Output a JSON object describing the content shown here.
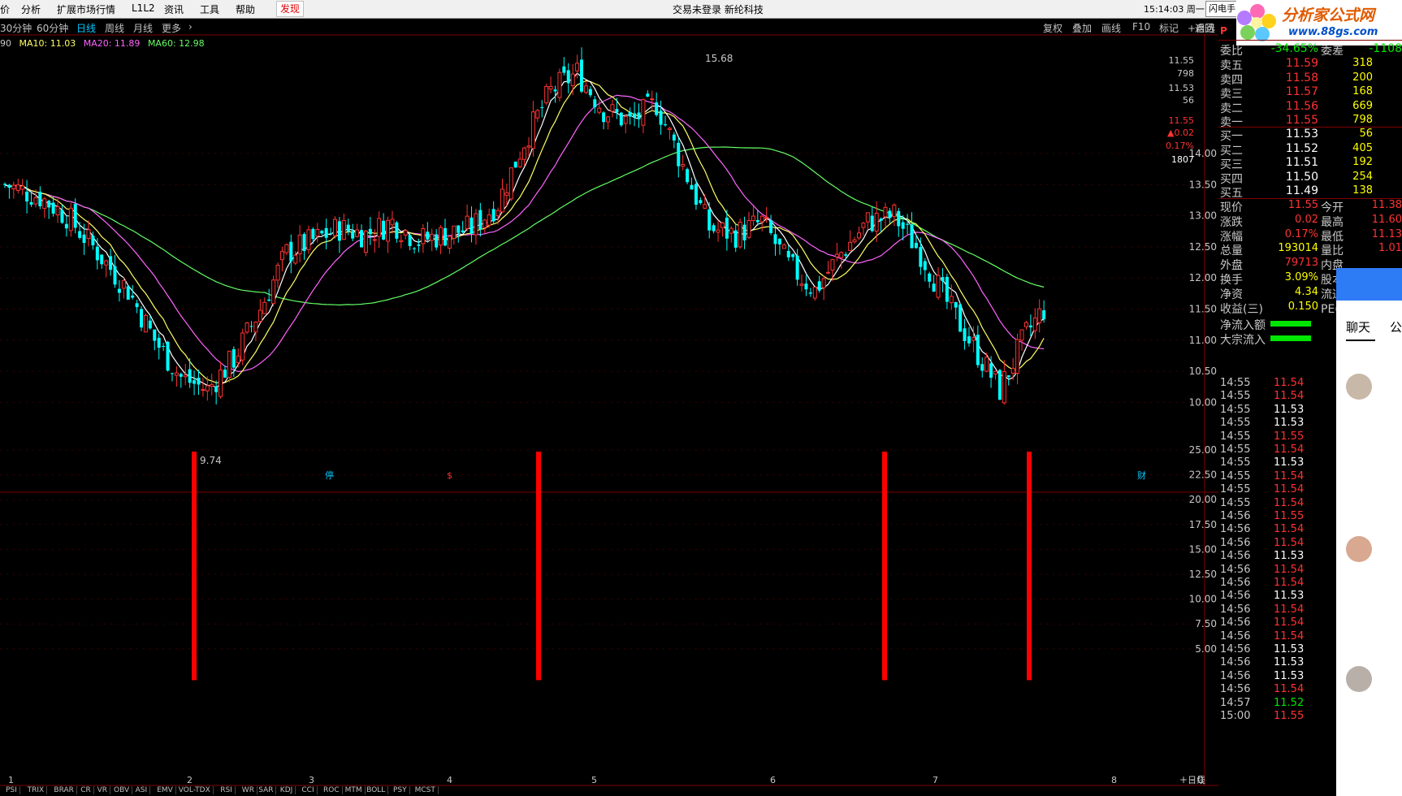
{
  "menu": {
    "items": [
      "价",
      "分析",
      "扩展市场行情",
      "L1L2",
      "资讯",
      "工具",
      "帮助",
      "发现"
    ],
    "center": "交易未登录    新纶科技",
    "clock": "15:14:03 周一",
    "flash": "闪电手"
  },
  "logo": {
    "title": "分析家公式网",
    "url": "www.88gs.com"
  },
  "toolbar": {
    "periods": [
      "30分钟",
      "60分钟",
      "日线",
      "周线",
      "月线",
      "更多"
    ],
    "active_period": "日线",
    "right": [
      "复权",
      "叠加",
      "画线",
      "F10",
      "标记",
      "+自选",
      "返回"
    ]
  },
  "ma": [
    {
      "label": "90",
      "color": "#c8c8c8"
    },
    {
      "label": "MA10: 11.03",
      "color": "#ffff64"
    },
    {
      "label": "MA20: 11.89",
      "color": "#ff64ff"
    },
    {
      "label": "MA60: 12.98",
      "color": "#64ff64"
    }
  ],
  "chart_labels": {
    "high_mark": "15.68",
    "low_mark": "9.74",
    "event_1": "停",
    "event_2": "$",
    "event_3": "财",
    "volume_unit": "日线",
    "top_price_1": "11.55",
    "top_vol_1": "798",
    "top_price_2": "11.53",
    "top_vol_2": "56",
    "top_price_3": "11.55",
    "top_chg": "▲0.02",
    "top_pct": "0.17%",
    "top_vol_3": "1807"
  },
  "price_axis": [
    "14.00",
    "13.50",
    "13.00",
    "12.50",
    "12.00",
    "11.50",
    "11.00",
    "10.50",
    "10.00"
  ],
  "ind_axis": [
    "25.00",
    "22.50",
    "20.00",
    "17.50",
    "15.00",
    "12.50",
    "10.00",
    "7.50",
    "5.00"
  ],
  "x_axis": [
    "1",
    "2",
    "3",
    "4",
    "5",
    "6",
    "7",
    "8"
  ],
  "quote": {
    "wei_bi_label": "委比",
    "wei_bi": "-34.65%",
    "wei_cha_label": "委差",
    "wei_cha": "-1108",
    "asks": [
      {
        "label": "卖五",
        "price": "11.59",
        "vol": "318"
      },
      {
        "label": "卖四",
        "price": "11.58",
        "vol": "200"
      },
      {
        "label": "卖三",
        "price": "11.57",
        "vol": "168"
      },
      {
        "label": "卖二",
        "price": "11.56",
        "vol": "669"
      },
      {
        "label": "卖一",
        "price": "11.55",
        "vol": "798"
      }
    ],
    "bids": [
      {
        "label": "买一",
        "price": "11.53",
        "vol": "56"
      },
      {
        "label": "买二",
        "price": "11.52",
        "vol": "405"
      },
      {
        "label": "买三",
        "price": "11.51",
        "vol": "192"
      },
      {
        "label": "买四",
        "price": "11.50",
        "vol": "254"
      },
      {
        "label": "买五",
        "price": "11.49",
        "vol": "138"
      }
    ],
    "stats": [
      {
        "l1": "现价",
        "v1": "11.55",
        "l2": "今开",
        "v2": "11.38"
      },
      {
        "l1": "涨跌",
        "v1": "0.02",
        "l2": "最高",
        "v2": "11.60"
      },
      {
        "l1": "涨幅",
        "v1": "0.17%",
        "l2": "最低",
        "v2": "11.13"
      },
      {
        "l1": "总量",
        "v1": "193014",
        "l2": "量比",
        "v2": "1.01"
      },
      {
        "l1": "外盘",
        "v1": "79713",
        "l2": "内盘",
        "v2": ""
      },
      {
        "l1": "换手",
        "v1": "3.09%",
        "l2": "股本",
        "v2": ""
      },
      {
        "l1": "净资",
        "v1": "4.34",
        "l2": "流通",
        "v2": ""
      },
      {
        "l1": "收益(三)",
        "v1": "0.150",
        "l2": "PE(动)",
        "v2": ""
      }
    ],
    "flow": [
      {
        "label": "净流入额",
        "val": "-4"
      },
      {
        "label": "大宗流入",
        "val": "-3"
      }
    ],
    "panel_mark": "P"
  },
  "ticks": [
    {
      "t": "14:55",
      "p": "11.54"
    },
    {
      "t": "14:55",
      "p": "11.54"
    },
    {
      "t": "14:55",
      "p": "11.53"
    },
    {
      "t": "14:55",
      "p": "11.53"
    },
    {
      "t": "14:55",
      "p": "11.55"
    },
    {
      "t": "14:55",
      "p": "11.54"
    },
    {
      "t": "14:55",
      "p": "11.53"
    },
    {
      "t": "14:55",
      "p": "11.54"
    },
    {
      "t": "14:55",
      "p": "11.54"
    },
    {
      "t": "14:55",
      "p": "11.54"
    },
    {
      "t": "14:56",
      "p": "11.55"
    },
    {
      "t": "14:56",
      "p": "11.54"
    },
    {
      "t": "14:56",
      "p": "11.54"
    },
    {
      "t": "14:56",
      "p": "11.53"
    },
    {
      "t": "14:56",
      "p": "11.54"
    },
    {
      "t": "14:56",
      "p": "11.54"
    },
    {
      "t": "14:56",
      "p": "11.53"
    },
    {
      "t": "14:56",
      "p": "11.54"
    },
    {
      "t": "14:56",
      "p": "11.54"
    },
    {
      "t": "14:56",
      "p": "11.54"
    },
    {
      "t": "14:56",
      "p": "11.53"
    },
    {
      "t": "14:56",
      "p": "11.53"
    },
    {
      "t": "14:56",
      "p": "11.53"
    },
    {
      "t": "14:56",
      "p": "11.54"
    },
    {
      "t": "14:57",
      "p": "11.52"
    },
    {
      "t": "15:00",
      "p": "11.55"
    }
  ],
  "chat": {
    "tab": "聊天",
    "tab2": "公"
  },
  "bottom_tabs": [
    "PSI",
    "TRIX",
    "BRAR",
    "CR",
    "VR",
    "OBV",
    "ASI",
    "EMV",
    "VOL-TDX",
    "RSI",
    "WR",
    "SAR",
    "KDJ",
    "CCI",
    "ROC",
    "MTM",
    "BOLL",
    "PSY",
    "MCST"
  ],
  "status_right": "+ - 0",
  "colors": {
    "up": "#ff3232",
    "down": "#00ffff",
    "ma5": "#ffffff",
    "ma10": "#ffff64",
    "ma20": "#ff64ff",
    "ma60": "#64ff64",
    "signal": "#ff0000"
  },
  "chart_data": {
    "type": "candlestick",
    "y_range": [
      9.7,
      15.8
    ],
    "high": 15.68,
    "low": 9.74,
    "signals": [
      1,
      1,
      1,
      1
    ],
    "signal_level": 25.0
  }
}
